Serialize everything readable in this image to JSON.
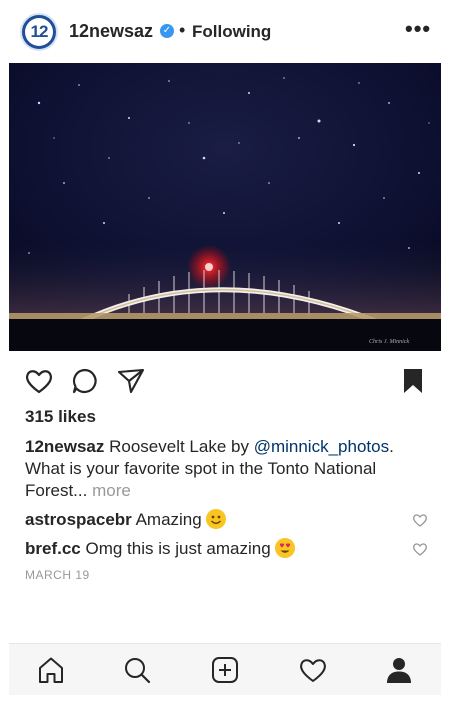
{
  "header": {
    "avatar_text": "12",
    "username": "12newsaz",
    "separator": "•",
    "follow_status": "Following",
    "more_label": "•••"
  },
  "post": {
    "image_watermark": "Chris J. Minnick",
    "likes": "315 likes",
    "caption": {
      "username": "12newsaz",
      "text_before_mention": " Roosevelt Lake by ",
      "mention": "@minnick_photos",
      "text_after_mention": ". What is your favorite spot in the Tonto National Forest...",
      "more_label": " more"
    },
    "comments": [
      {
        "username": "astrospacebr",
        "text": " Amazing",
        "emoji": "smiling-face"
      },
      {
        "username": "bref.cc",
        "text": " Omg this is just amazing",
        "emoji": "heart-eyes-face"
      }
    ],
    "date": "MARCH 19"
  },
  "icons": {
    "actions": [
      "heart-icon",
      "comment-icon",
      "share-icon",
      "bookmark-icon"
    ],
    "tabbar": [
      "home-icon",
      "search-icon",
      "add-post-icon",
      "activity-heart-icon",
      "profile-icon"
    ]
  },
  "colors": {
    "verified": "#3897f0",
    "mention": "#003569",
    "muted": "#999999",
    "night_sky": "#0a0c22",
    "bridge_light": "#ff2a2a"
  }
}
